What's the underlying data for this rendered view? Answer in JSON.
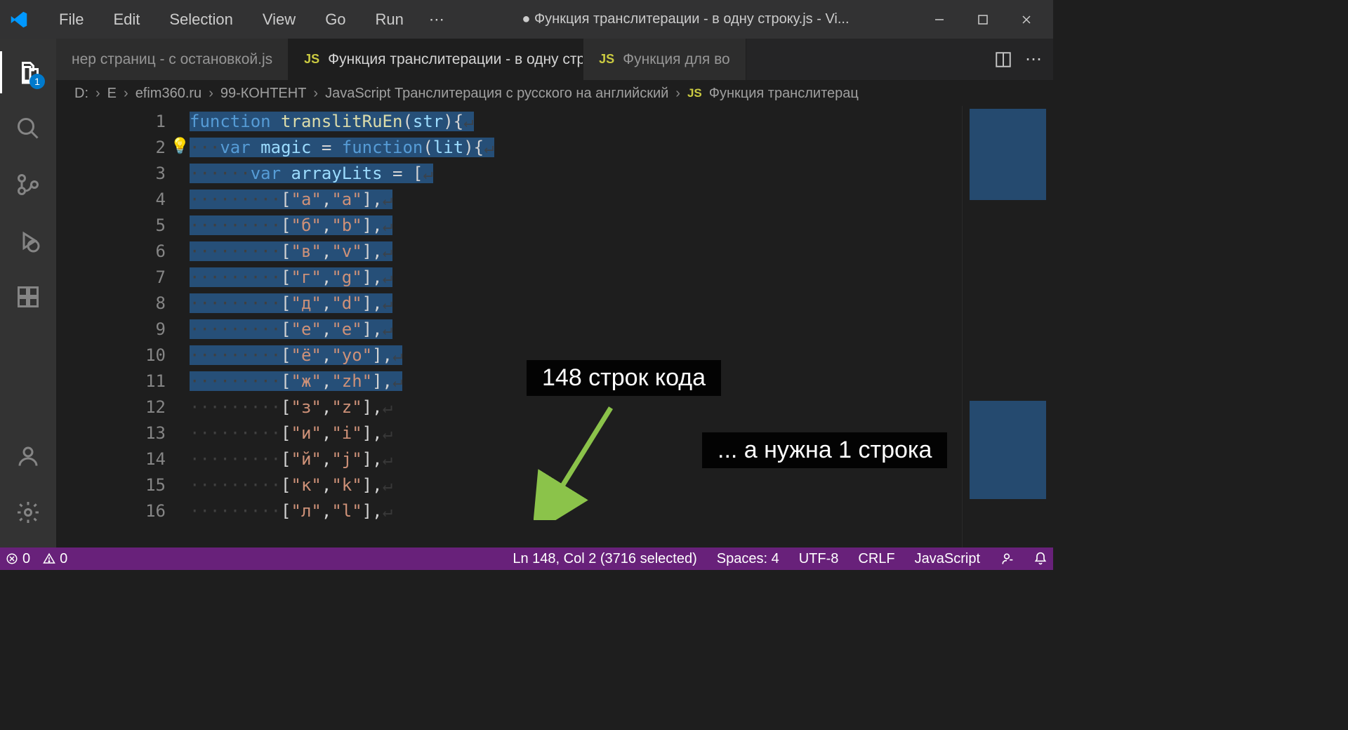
{
  "title": "● Функция транслитерации - в одну строку.js - Vi...",
  "menu": [
    "File",
    "Edit",
    "Selection",
    "View",
    "Go",
    "Run"
  ],
  "tabs": [
    {
      "label": "нер страниц - с остановкой.js",
      "active": false,
      "dirty": false,
      "js": false
    },
    {
      "label": "Функция транслитерации - в одну строку.js",
      "active": true,
      "dirty": true,
      "js": true
    },
    {
      "label": "Функция для во",
      "active": false,
      "dirty": false,
      "js": true
    }
  ],
  "breadcrumbs": [
    "D:",
    "E",
    "efim360.ru",
    "99-КОНТЕНТ",
    "JavaScript Транслитерация с русского на английский",
    "Функция транслитерац"
  ],
  "activity_badge": "1",
  "code": {
    "lines": [
      {
        "n": 1,
        "kw": "function",
        "rest": " translitRuEn(str){",
        "type": "fnhead"
      },
      {
        "n": 2,
        "indent": 1,
        "kw": "var",
        "rest": " magic = function(lit){",
        "type": "varfn"
      },
      {
        "n": 3,
        "indent": 2,
        "kw": "var",
        "rest": " arrayLits = [",
        "type": "vararr"
      },
      {
        "n": 4,
        "indent": 3,
        "pair": [
          "а",
          "a"
        ]
      },
      {
        "n": 5,
        "indent": 3,
        "pair": [
          "б",
          "b"
        ]
      },
      {
        "n": 6,
        "indent": 3,
        "pair": [
          "в",
          "v"
        ]
      },
      {
        "n": 7,
        "indent": 3,
        "pair": [
          "г",
          "g"
        ]
      },
      {
        "n": 8,
        "indent": 3,
        "pair": [
          "д",
          "d"
        ]
      },
      {
        "n": 9,
        "indent": 3,
        "pair": [
          "е",
          "e"
        ]
      },
      {
        "n": 10,
        "indent": 3,
        "pair": [
          "ё",
          "yo"
        ]
      },
      {
        "n": 11,
        "indent": 3,
        "pair": [
          "ж",
          "zh"
        ]
      },
      {
        "n": 12,
        "indent": 3,
        "pair": [
          "з",
          "z"
        ]
      },
      {
        "n": 13,
        "indent": 3,
        "pair": [
          "и",
          "i"
        ]
      },
      {
        "n": 14,
        "indent": 3,
        "pair": [
          "й",
          "j"
        ]
      },
      {
        "n": 15,
        "indent": 3,
        "pair": [
          "к",
          "k"
        ]
      },
      {
        "n": 16,
        "indent": 3,
        "pair": [
          "л",
          "l"
        ]
      }
    ],
    "selected_upto_line": 11
  },
  "annotations": {
    "a1": "148 строк кода",
    "a2": "... а нужна 1 строка"
  },
  "status": {
    "errors": "0",
    "warnings": "0",
    "cursor": "Ln 148, Col 2 (3716 selected)",
    "spaces": "Spaces: 4",
    "encoding": "UTF-8",
    "eol": "CRLF",
    "lang": "JavaScript"
  }
}
